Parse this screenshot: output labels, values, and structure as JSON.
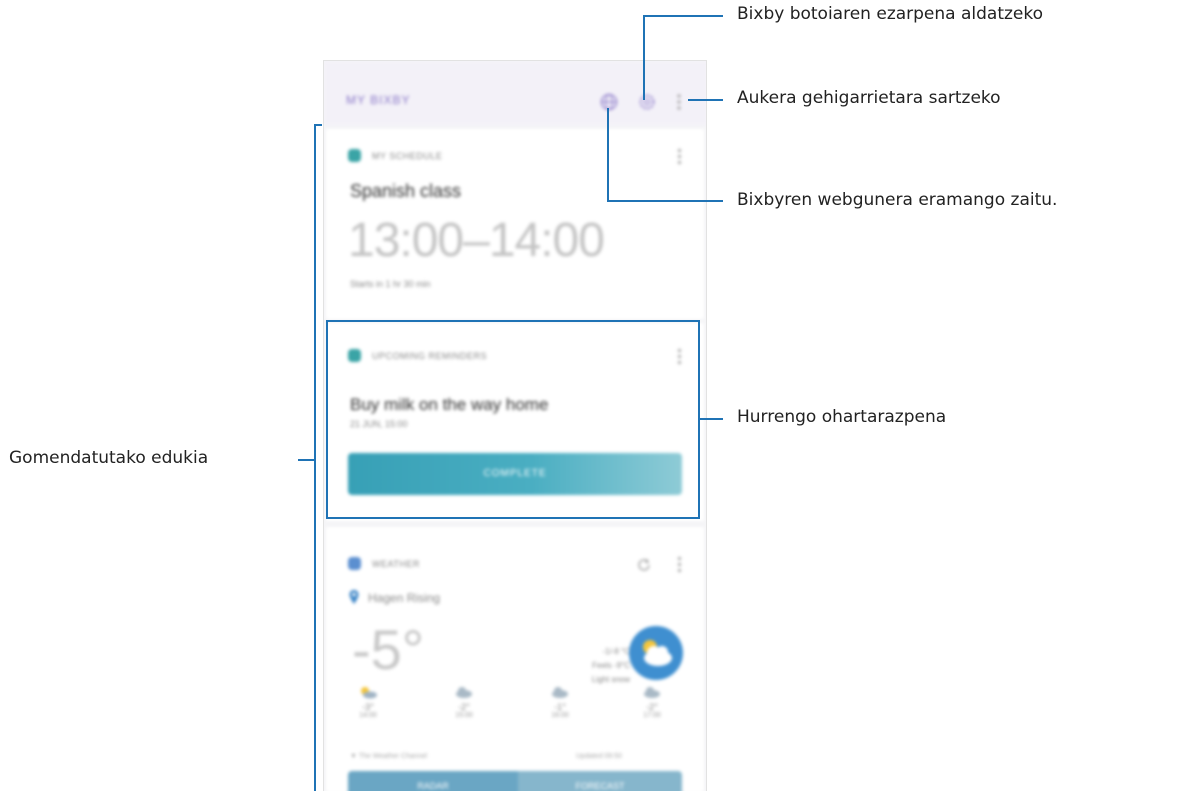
{
  "callouts": {
    "bixby_button": "Bixby botoiaren ezarpena aldatzeko",
    "more_options": "Aukera gehigarrietara sartzeko",
    "website": "Bixbyren webgunera eramango zaitu.",
    "next_reminder": "Hurrengo ohartarazpena",
    "recommended": "Gomendatutako edukia"
  },
  "screen": {
    "header": {
      "title": "MY BIXBY"
    },
    "schedule_card": {
      "app_label": "MY SCHEDULE",
      "event_title": "Spanish class",
      "time": "13:00–14:00",
      "sub": "Starts in 1 hr 30 min"
    },
    "reminder_card": {
      "app_label": "UPCOMING REMINDERS",
      "title": "Buy milk on the way home",
      "sub": "21 JUN, 15:00",
      "button": "COMPLETE"
    },
    "weather_card": {
      "app_label": "WEATHER",
      "location": "Hagen Rising",
      "temp_now": "-5°",
      "info": [
        "-1/-8 °C",
        "Feels -9°C",
        "Light snow"
      ],
      "forecast": [
        {
          "day": "14:00",
          "temp": "-3°",
          "icon": "sun-cloud-icon"
        },
        {
          "day": "15:00",
          "temp": "-2°",
          "icon": "cloud-icon"
        },
        {
          "day": "16:00",
          "temp": "-1°",
          "icon": "cloud-icon"
        },
        {
          "day": "17:00",
          "temp": "-2°",
          "icon": "cloud-icon"
        }
      ],
      "footer_left": "▼ The Weather Channel",
      "footer_right": "Updated 09:50",
      "buttons": [
        "RADAR",
        "FORECAST"
      ]
    }
  },
  "colors": {
    "callout_line": "#1f73b5",
    "accent": "#3aa4a6"
  }
}
